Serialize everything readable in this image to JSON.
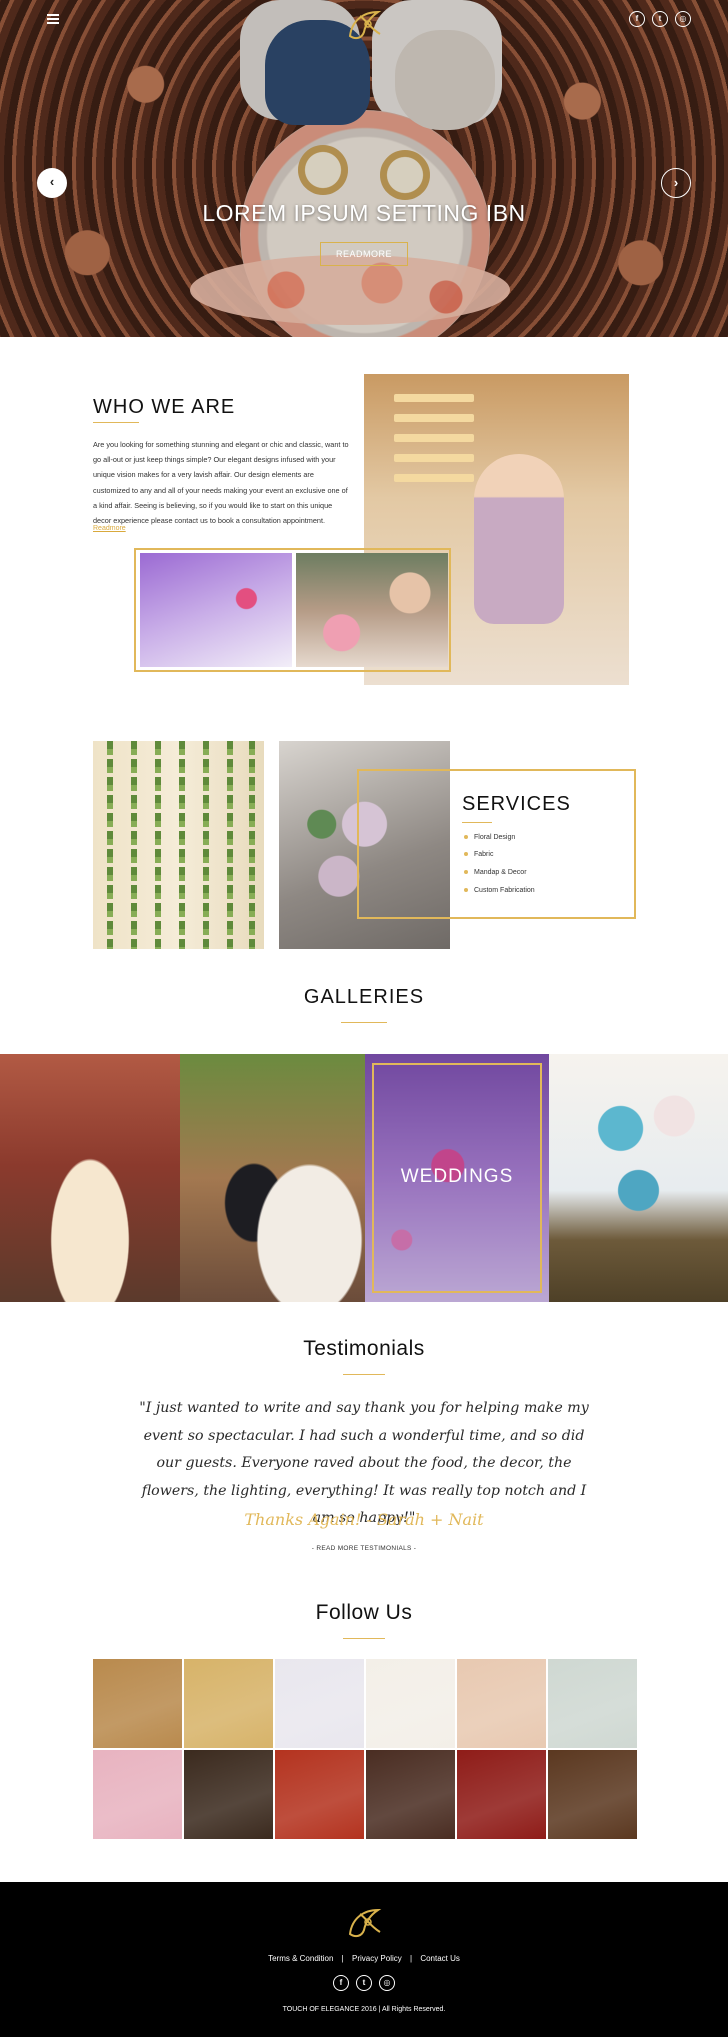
{
  "header": {
    "menu_icon": "hamburger-menu-icon",
    "logo_icon": "touch-of-elegance-logo-icon",
    "social": [
      "facebook-icon",
      "twitter-icon",
      "instagram-icon"
    ],
    "social_glyphs": [
      "f",
      "t",
      "◎"
    ]
  },
  "hero": {
    "title": "LOREM IPSUM SETTING IBN",
    "button_label": "READMORE",
    "prev_glyph": "‹",
    "next_glyph": "›"
  },
  "who": {
    "title": "WHO WE ARE",
    "body": "Are you looking for something stunning and elegant or chic and classic, want to go all-out or just keep things simple? Our elegant designs infused with your unique vision makes for a very lavish affair. Our design elements are customized to any and all of your needs making your event an exclusive one of a kind affair. Seeing is believing, so if you would like to start on this unique decor experience please contact us to book a consultation appointment.",
    "link": "Readmore"
  },
  "services": {
    "title": "SERVICES",
    "items": [
      "Floral Design",
      "Fabric",
      "Mandap & Decor",
      "Custom Fabrication"
    ]
  },
  "galleries": {
    "title": "GALLERIES",
    "featured_label": "WEDDINGS"
  },
  "testimonials": {
    "title": "Testimonials",
    "quote": "\"I just wanted to write and say thank you for helping make my event so spectacular. I had such a wonderful time, and so did our guests. Everyone raved about the food, the decor, the flowers, the lighting, everything! It was really top notch and I am so happy!\"",
    "signature": "Thanks Again! - Sarah + Nait",
    "more_link": "- READ MORE TESTIMONIALS -"
  },
  "follow": {
    "title": "Follow Us",
    "tile_colors": [
      "#b98a4d",
      "#d7b369",
      "#e9e7ee",
      "#f3efe8",
      "#e8c9b1",
      "#cfd8d2",
      "#e8b3c0",
      "#3b2a1e",
      "#b4331f",
      "#4a2d22",
      "#8f1c18",
      "#5b3820"
    ]
  },
  "footer": {
    "links": [
      "Terms & Condition",
      "Privacy Policy",
      "Contact Us"
    ],
    "separator": "|",
    "copyright": "TOUCH OF ELEGANCE 2016 | All Rights Reserved."
  },
  "colors": {
    "accent_gold": "#e1b85a",
    "footer_bg": "#000000"
  }
}
